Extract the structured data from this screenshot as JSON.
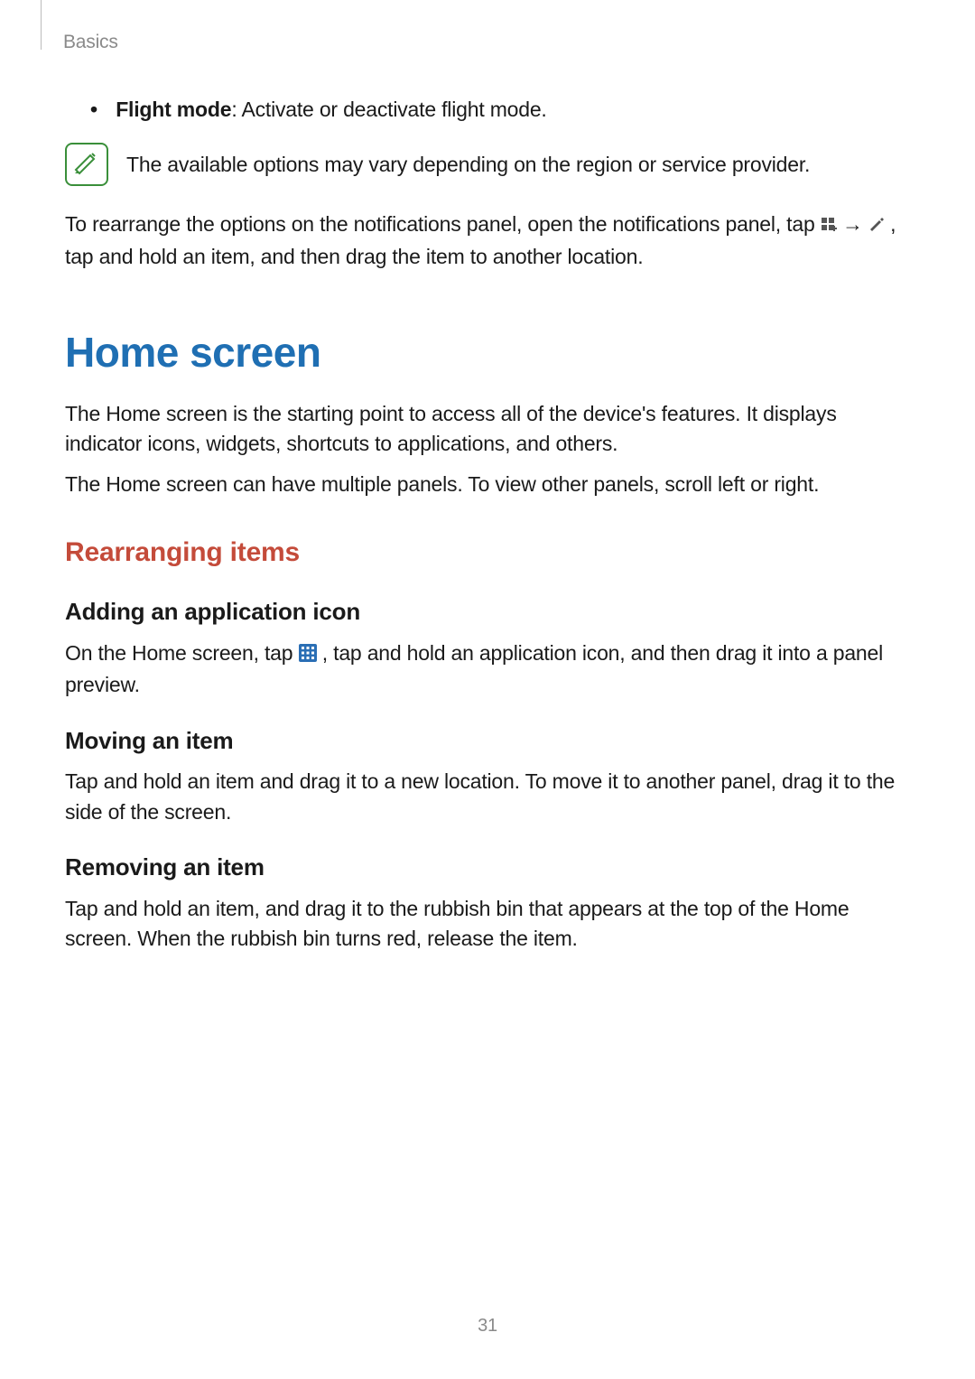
{
  "breadcrumb": "Basics",
  "flight_mode_label": "Flight mode",
  "flight_mode_text": ": Activate or deactivate flight mode.",
  "note_text": "The available options may vary depending on the region or service provider.",
  "rearrange_para_1": "To rearrange the options on the notifications panel, open the notifications panel, tap ",
  "rearrange_arrow": " → ",
  "rearrange_para_2": " , tap and hold an item, and then drag the item to another location.",
  "h1_home": "Home screen",
  "home_para1": "The Home screen is the starting point to access all of the device's features. It displays indicator icons, widgets, shortcuts to applications, and others.",
  "home_para2": "The Home screen can have multiple panels. To view other panels, scroll left or right.",
  "h2_rearranging": "Rearranging items",
  "h3_adding": "Adding an application icon",
  "adding_para_1": "On the Home screen, tap ",
  "adding_para_2": ", tap and hold an application icon, and then drag it into a panel preview.",
  "h3_moving": "Moving an item",
  "moving_para": "Tap and hold an item and drag it to a new location. To move it to another panel, drag it to the side of the screen.",
  "h3_removing": "Removing an item",
  "removing_para": "Tap and hold an item, and drag it to the rubbish bin that appears at the top of the Home screen. When the rubbish bin turns red, release the item.",
  "page_number": "31"
}
